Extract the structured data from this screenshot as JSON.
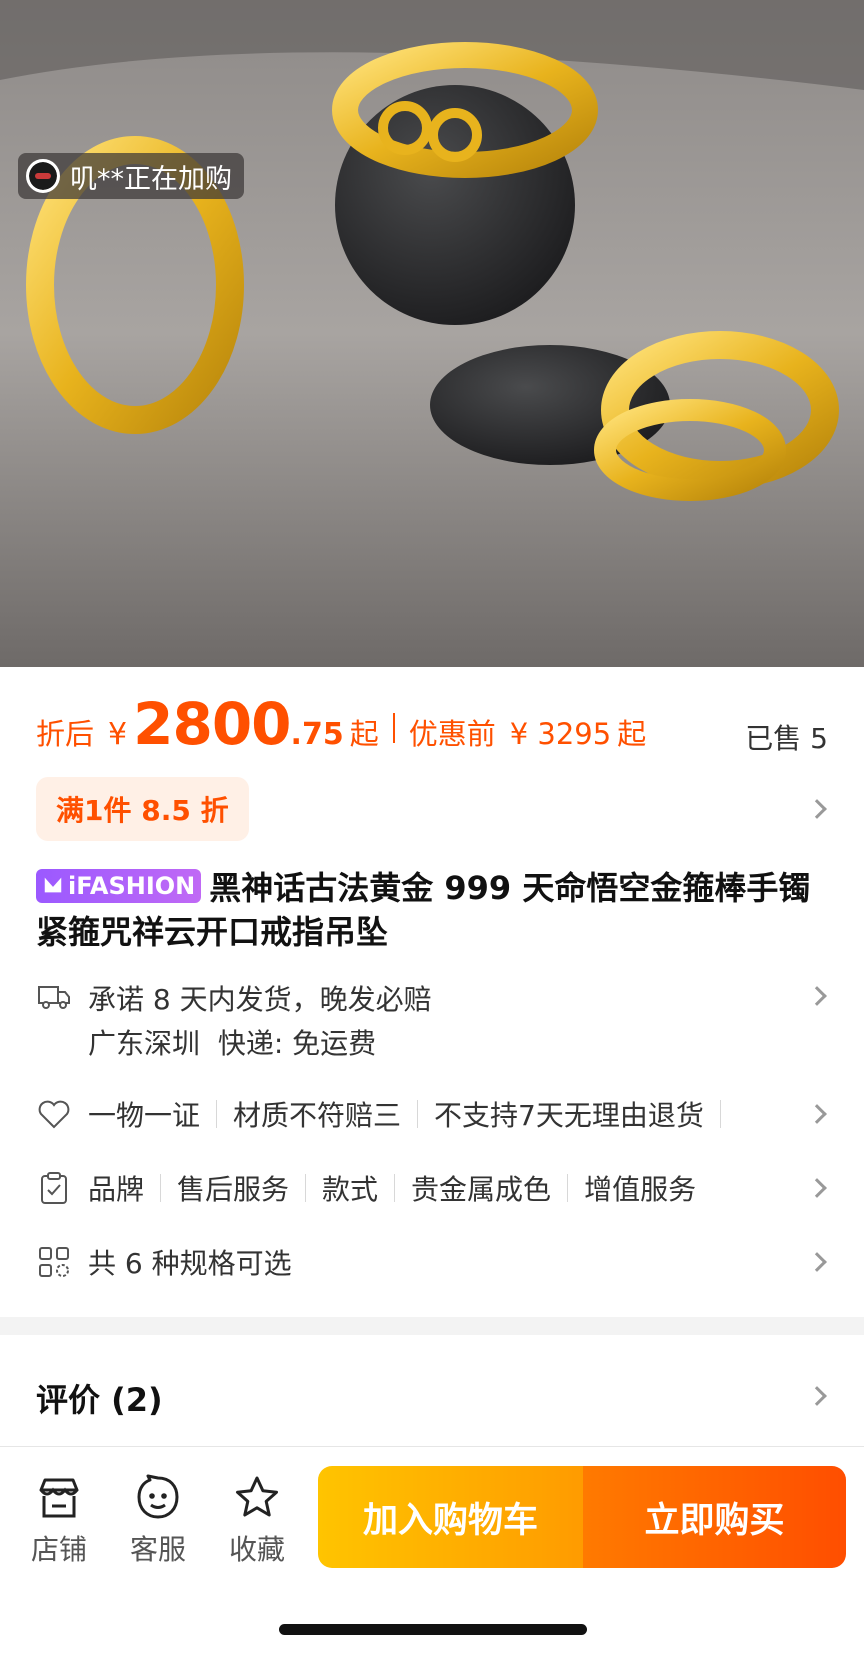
{
  "hero": {
    "buyer_toast": "叽**正在加购"
  },
  "price": {
    "prefix": "折后",
    "currency": "¥",
    "integer": "2800",
    "decimal": ".75",
    "suffix": "起",
    "original_label": "优惠前",
    "original_value": "¥ 3295",
    "original_suffix": "起",
    "sold": "已售 5"
  },
  "discount": {
    "label": "满1件 8.5 折"
  },
  "title": {
    "brand_badge": "iFASHION",
    "text": "黑神话古法黄金 999 天命悟空金箍棒手镯紧箍咒祥云开口戒指吊坠"
  },
  "shipping": {
    "promise": "承诺 8 天内发货，晚发必赔",
    "location": "广东深圳",
    "express": "快递: 免运费"
  },
  "guarantees": [
    "一物一证",
    "材质不符赔三",
    "不支持7天无理由退货"
  ],
  "params": [
    "品牌",
    "售后服务",
    "款式",
    "贵金属成色",
    "增值服务"
  ],
  "specs": {
    "label": "共 6 种规格可选"
  },
  "reviews": {
    "label": "评价 (2)"
  },
  "bottom_bar": {
    "store": "店铺",
    "service": "客服",
    "favorite": "收藏",
    "add_to_cart": "加入购物车",
    "buy_now": "立即购买"
  },
  "colors": {
    "accent": "#ff5000",
    "cart_button": "#ffb400",
    "buy_button": "#ff5a00",
    "discount_bg": "#fff0e6",
    "brand_badge": "#a862f8"
  },
  "icons": {
    "truck": "truck-icon",
    "heart": "heart-tag-icon",
    "clipboard": "clipboard-check-icon",
    "grid": "grid-icon",
    "store": "store-icon",
    "service": "chat-face-icon",
    "favorite": "star-icon"
  }
}
